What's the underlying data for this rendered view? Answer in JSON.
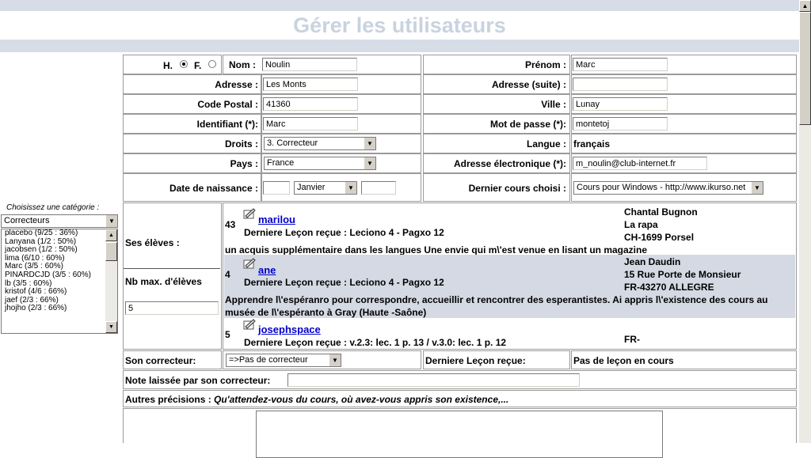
{
  "page": {
    "title": "Gérer les utilisateurs"
  },
  "gender": {
    "male_label": "H.",
    "female_label": "F.",
    "selected": "H."
  },
  "form": {
    "nom_label": "Nom :",
    "nom_value": "Noulin",
    "prenom_label": "Prénom :",
    "prenom_value": "Marc",
    "adresse_label": "Adresse :",
    "adresse_value": "Les Monts",
    "adresse2_label": "Adresse (suite) :",
    "adresse2_value": "",
    "cp_label": "Code Postal :",
    "cp_value": "41360",
    "ville_label": "Ville :",
    "ville_value": "Lunay",
    "ident_label": "Identifiant (*):",
    "ident_value": "Marc",
    "mdp_label": "Mot de passe (*):",
    "mdp_value": "montetoj",
    "droits_label": "Droits :",
    "droits_value": "3. Correcteur",
    "langue_label": "Langue :",
    "langue_value": "français",
    "pays_label": "Pays :",
    "pays_value": "France",
    "email_label": "Adresse électronique (*):",
    "email_value": "m_noulin@club-internet.fr",
    "dob_label": "Date de naissance :",
    "dob_day": "",
    "dob_month": "Janvier",
    "dob_year": "",
    "cours_label": "Dernier cours choisi :",
    "cours_value": "Cours pour Windows - http://www.ikurso.net"
  },
  "sidebar": {
    "category_prompt": "Choisissez une catégorie :",
    "category_selected": "Correcteurs",
    "items": [
      "placebo (9/25 : 36%)",
      "Lanyana (1/2 : 50%)",
      "jacobsen (1/2 : 50%)",
      "lima (6/10 : 60%)",
      "Marc (3/5 : 60%)",
      "PINARDCJD (3/5 : 60%)",
      "lb (3/5 : 60%)",
      "kristof (4/6 : 66%)",
      "jaef (2/3 : 66%)",
      "jhojho (2/3 : 66%)"
    ]
  },
  "students": {
    "label": "Ses élèves :",
    "max_label": "Nb max. d'élèves",
    "max_value": "5",
    "rows": [
      {
        "num": "43",
        "name": "marilou",
        "lesson": "Derniere Leçon reçue : Leciono 4 - Pagxo 12",
        "addr1": "Chantal Bugnon",
        "addr2": "La rapa",
        "addr3": "CH-1699 Porsel",
        "desc": "un acquis supplémentaire dans les langues Une envie qui m\\'est venue en lisant un magazine"
      },
      {
        "num": "4",
        "name": "ane",
        "lesson": "Derniere Leçon reçue : Leciono 4 - Pagxo 12",
        "addr1": "Jean Daudin",
        "addr2": "15 Rue Porte de Monsieur",
        "addr3": "FR-43270 ALLEGRE",
        "desc": "Apprendre l\\'espéranro pour correspondre, accueillir et rencontrer des esperantistes. Ai appris l\\'existence des cours au musée de l\\'espéranto à Gray (Haute -Saône)"
      },
      {
        "num": "5",
        "name": "josephspace",
        "lesson": "Derniere Leçon reçue : v.2.3: lec. 1 p. 13 / v.3.0: lec. 1 p. 12",
        "addr1": "FR-"
      }
    ]
  },
  "correcteur": {
    "label": "Son correcteur:",
    "value": "=>Pas de correcteur",
    "last_lesson_label": "Derniere Leçon reçue:",
    "last_lesson_value": "Pas de leçon en cours"
  },
  "note": {
    "label": "Note laissée par son correcteur:",
    "value": ""
  },
  "autres": {
    "label": "Autres précisions :",
    "hint": "Qu'attendez-vous du cours, où avez-vous appris son existence,..."
  }
}
